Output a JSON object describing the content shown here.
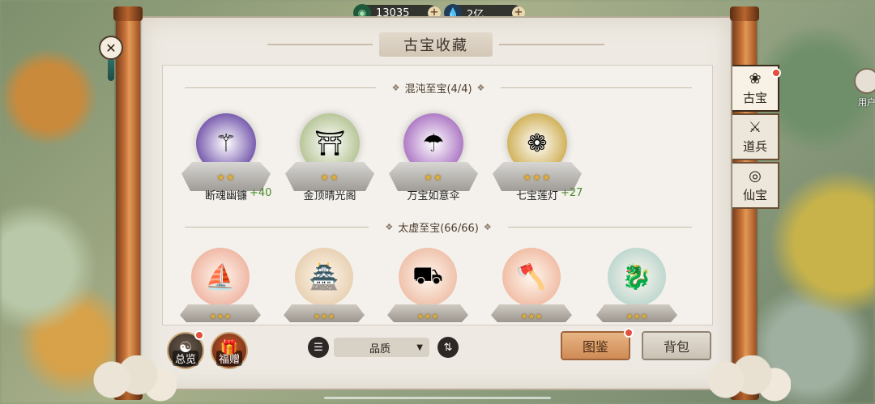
{
  "resources": {
    "jade": {
      "value": "13035",
      "icon": "jade-coin-icon"
    },
    "spirit": {
      "value": "2亿",
      "icon": "water-drop-icon"
    }
  },
  "title": "古宝收藏",
  "sections": {
    "chaos": {
      "label": "混沌至宝(4/4)",
      "items": [
        {
          "name": "断魂幽镰",
          "stars": "★★",
          "bonus": "+40",
          "icon": "scythe-icon",
          "color": "#7b5fb0"
        },
        {
          "name": "金顶晴光阁",
          "stars": "★★",
          "bonus": "",
          "icon": "pavilion-icon",
          "color": "#b9c79a"
        },
        {
          "name": "万宝如意伞",
          "stars": "★★",
          "bonus": "",
          "icon": "umbrella-icon",
          "color": "#b07cc6"
        },
        {
          "name": "七宝莲灯",
          "stars": "★★★",
          "bonus": "+27",
          "icon": "lotus-lamp-icon",
          "color": "#d2b45e"
        }
      ]
    },
    "void": {
      "label": "太虚至宝(66/66)",
      "items": [
        {
          "icon": "dragon-boat-icon",
          "color": "#f0b9a7",
          "stars": "★★★"
        },
        {
          "icon": "tree-house-icon",
          "color": "#e8d2b4",
          "stars": "★★★"
        },
        {
          "icon": "cart-icon",
          "color": "#efc3ad",
          "stars": "★★★"
        },
        {
          "icon": "axe-icon",
          "color": "#f1bfa8",
          "stars": "★★★"
        },
        {
          "icon": "serpent-icon",
          "color": "#bfd8d0",
          "stars": "★★★"
        }
      ]
    }
  },
  "tabs": [
    {
      "label": "古宝",
      "icon": "treasure-icon",
      "active": true
    },
    {
      "label": "道兵",
      "icon": "weapon-icon",
      "active": false
    },
    {
      "label": "仙宝",
      "icon": "immortal-icon",
      "active": false
    }
  ],
  "side_user": "用户",
  "bottom": {
    "overview": "总览",
    "gift": "福赠",
    "sort_label": "品质",
    "codex": "图鉴",
    "bag": "背包"
  }
}
